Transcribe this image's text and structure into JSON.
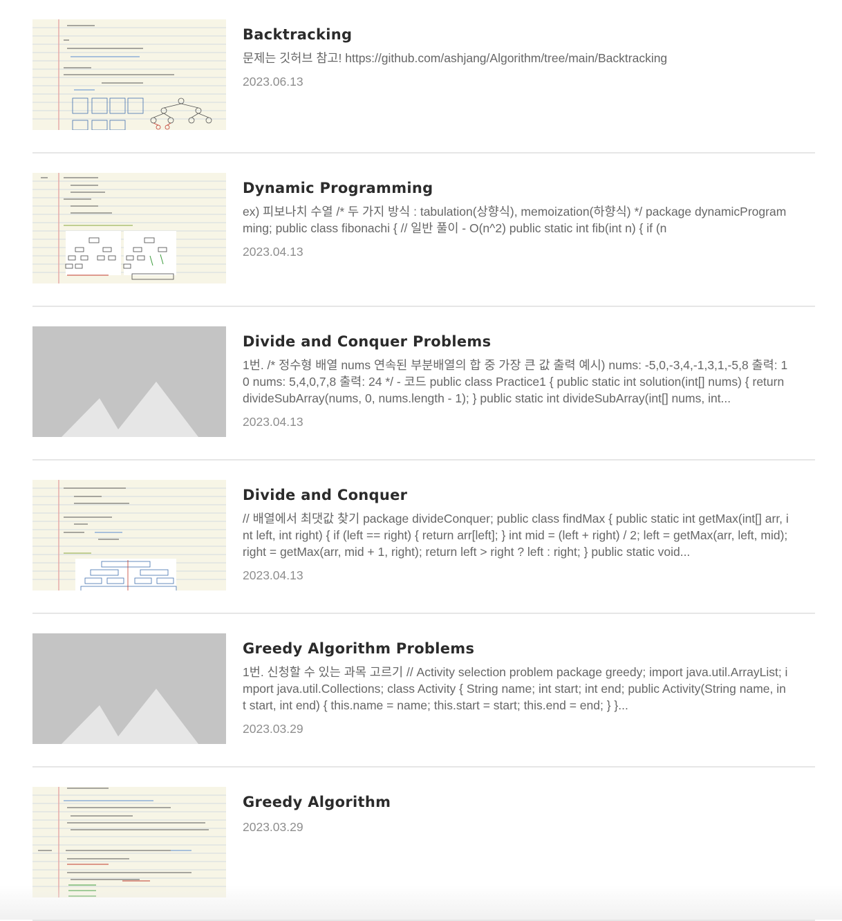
{
  "posts": [
    {
      "title": "Backtracking",
      "excerpt": "문제는 깃허브 참고! https://github.com/ashjang/Algorithm/tree/main/Backtracking",
      "date": "2023.06.13",
      "thumbnail": "notebook-photo"
    },
    {
      "title": "Dynamic Programming",
      "excerpt": "ex) 피보나치 수열 /* 두 가지 방식 : tabulation(상향식), memoization(하향식) */ package dynamicProgramming; public class fibonachi { // 일반 풀이 - O(n^2) public static int fib(int n) { if (n",
      "date": "2023.04.13",
      "thumbnail": "notebook-photo"
    },
    {
      "title": "Divide and Conquer Problems",
      "excerpt": "1번. /* 정수형 배열 nums 연속된 부분배열의 합 중 가장 큰 값 출력 예시) nums: -5,0,-3,4,-1,3,1,-5,8 출력: 10 nums: 5,4,0,7,8 출력: 24 */ - 코드 public class Practice1 { public static int solution(int[] nums) { return divideSubArray(nums, 0, nums.length - 1); } public static int divideSubArray(int[] nums, int...",
      "date": "2023.04.13",
      "thumbnail": "placeholder-image"
    },
    {
      "title": "Divide and Conquer",
      "excerpt": "// 배열에서 최댓값 찾기 package divideConquer; public class findMax { public static int getMax(int[] arr, int left, int right) { if (left == right) { return arr[left]; } int mid = (left + right) / 2; left = getMax(arr, left, mid); right = getMax(arr, mid + 1, right); return left > right ? left : right; } public static void...",
      "date": "2023.04.13",
      "thumbnail": "notebook-photo"
    },
    {
      "title": "Greedy Algorithm Problems",
      "excerpt": "1번. 신청할 수 있는 과목 고르기 // Activity selection problem package greedy; import java.util.ArrayList; import java.util.Collections; class Activity { String name; int start; int end; public Activity(String name, int start, int end) { this.name = name; this.start = start; this.end = end; } }...",
      "date": "2023.03.29",
      "thumbnail": "placeholder-image"
    },
    {
      "title": "Greedy Algorithm",
      "excerpt": "",
      "date": "2023.03.29",
      "thumbnail": "notebook-photo"
    }
  ],
  "colors": {
    "paper": "#f7f5e6",
    "paper_line": "#cfd8de",
    "margin_line": "#e08a8a",
    "placeholder_bg": "#c4c4c4",
    "placeholder_mountain": "#e6e6e6",
    "divider": "#e6e6e6"
  }
}
